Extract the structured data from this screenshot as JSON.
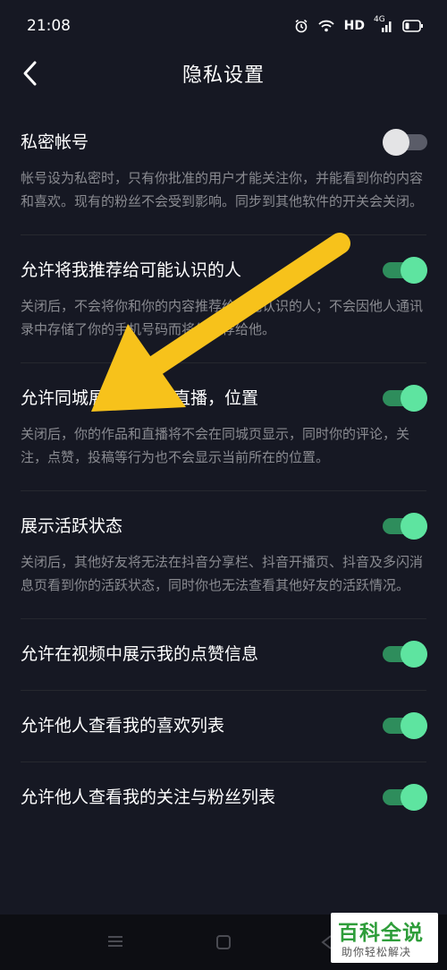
{
  "status": {
    "time": "21:08",
    "hd": "HD",
    "network": "4G"
  },
  "header": {
    "title": "隐私设置",
    "back_icon": "chevron-left-icon"
  },
  "settings": [
    {
      "title": "私密帐号",
      "desc": "帐号设为私密时，只有你批准的用户才能关注你，并能看到你的内容和喜欢。现有的粉丝不会受到影响。同步到其他软件的开关会关闭。",
      "on": false
    },
    {
      "title": "允许将我推荐给可能认识的人",
      "desc": "关闭后，不会将你和你的内容推荐给可能认识的人；不会因他人通讯录中存储了你的手机号码而将你推荐给他。",
      "on": true
    },
    {
      "title": "允许同城展示作品，直播，位置",
      "desc": "关闭后，你的作品和直播将不会在同城页显示，同时你的评论，关注，点赞，投稿等行为也不会显示当前所在的位置。",
      "on": true
    },
    {
      "title": "展示活跃状态",
      "desc": "关闭后，其他好友将无法在抖音分享栏、抖音开播页、抖音及多闪消息页看到你的活跃状态，同时你也无法查看其他好友的活跃情况。",
      "on": true
    },
    {
      "title": "允许在视频中展示我的点赞信息",
      "on": true
    },
    {
      "title": "允许他人查看我的喜欢列表",
      "on": true
    },
    {
      "title": "允许他人查看我的关注与粉丝列表",
      "on": true
    }
  ],
  "colors": {
    "background": "#161823",
    "toggle_on": "#5ee4a0",
    "toggle_off": "#e4e4e6",
    "annotation_arrow": "#f7c21b"
  },
  "watermark": {
    "main": "百科全说",
    "sub": "助你轻松解决"
  }
}
